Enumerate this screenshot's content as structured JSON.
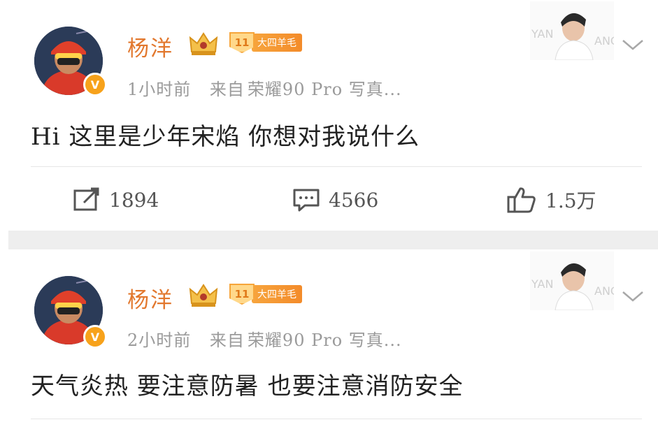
{
  "posts": [
    {
      "username": "杨洋",
      "level": "11",
      "level_title": "大四羊毛",
      "verified_badge": "V",
      "time": "1小时前",
      "source_prefix": "来自",
      "source": "荣耀90 Pro 写真...",
      "content": "Hi 这里是少年宋焰 你想对我说什么",
      "card_text_left": "YAN",
      "card_text_right": "ANG",
      "actions": {
        "repost_count": "1894",
        "comment_count": "4566",
        "like_count": "1.5万"
      }
    },
    {
      "username": "杨洋",
      "level": "11",
      "level_title": "大四羊毛",
      "verified_badge": "V",
      "time": "2小时前",
      "source_prefix": "来自",
      "source": "荣耀90 Pro 写真...",
      "content": "天气炎热 要注意防暑 也要注意消防安全",
      "card_text_left": "YAN",
      "card_text_right": "ANG"
    }
  ],
  "icons": {
    "repost": "repost-icon",
    "comment": "comment-icon",
    "like": "thumbs-up-icon",
    "chevron": "chevron-down-icon",
    "crown": "crown-icon"
  },
  "colors": {
    "username": "#e2782e",
    "meta": "#9a9a9a",
    "badge_orange": "#f7a21b",
    "separator": "#eeeeee"
  }
}
